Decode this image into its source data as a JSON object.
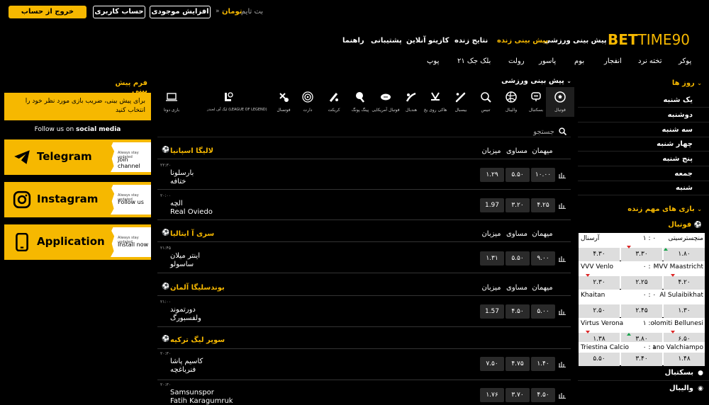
{
  "header": {
    "logout": "خروج از حساب کاربری",
    "account": "حساب کاربری",
    "deposit": "افزایش موجودی",
    "currency": "تومان",
    "balance_sep": "» ۰",
    "site_name": "بت تایم",
    "logo_bet": "BET",
    "logo_time": "TIME90"
  },
  "nav_main": [
    "پیش بینی ورزشی",
    "پیش بینی زنده",
    "نتایج زنده",
    "کازینو آنلاین",
    "پشتیبانی",
    "راهنما"
  ],
  "nav_casino": [
    "پوکر",
    "تخته نرد",
    "انفجار",
    "بوم",
    "پاسور",
    "رولت",
    "بلک جک ۲۱",
    "پوپ"
  ],
  "left": {
    "title": "فرم پیش بینی",
    "promo": "برای پیش بینی، ضریب بازی مورد نظر خود را انتخاب کنید",
    "follow_prefix": "Follow us on",
    "follow_bold": "social media",
    "socials": [
      {
        "title": "Telegram",
        "small": "Always stay updated",
        "action": "Join channel"
      },
      {
        "title": "Instagram",
        "small": "Always stay updated",
        "action": "Follow us"
      },
      {
        "title": "Application",
        "small": "Always stay updated",
        "action": "Install now"
      }
    ]
  },
  "center": {
    "title": "پیش بینی ورزشی",
    "search_placeholder": "جستجو",
    "sports": [
      {
        "label": "فوتبال",
        "icon": "soccer-ball-icon"
      },
      {
        "label": "بسکتبال",
        "icon": "basketball-icon"
      },
      {
        "label": "والیبال",
        "icon": "volleyball-icon"
      },
      {
        "label": "تنیس",
        "icon": "tennis-icon"
      },
      {
        "label": "بیسبال",
        "icon": "baseball-icon"
      },
      {
        "label": "هاکی روی یخ",
        "icon": "hockey-icon"
      },
      {
        "label": "هندبال",
        "icon": "handball-icon"
      },
      {
        "label": "فوتبال آمریکایی",
        "icon": "american-football-icon"
      },
      {
        "label": "پینگ پونگ",
        "icon": "ping-pong-icon"
      },
      {
        "label": "کریکت",
        "icon": "cricket-icon"
      },
      {
        "label": "دارت",
        "icon": "darts-icon"
      },
      {
        "label": "فوتسال",
        "icon": "futsal-icon"
      },
      {
        "label": "لیگ آف لجندز (LEAGUE OF LEGEND)",
        "icon": "league-of-legends-icon"
      },
      {
        "label": "بازی دوتا",
        "icon": "dota-icon"
      }
    ],
    "col_headers": {
      "home": "میزبان",
      "draw": "مساوی",
      "away": "میهمان"
    },
    "leagues": [
      {
        "name": "لالیگا اسپانیا",
        "matches": [
          {
            "time": "۲۲:۳۰",
            "home": "بارسلونا",
            "away": "ختافه",
            "o1": "۱.۲۹",
            "ox": "۵.۵۰",
            "o2": "۱۰.۰۰"
          },
          {
            "time": "۲۰:۰۰",
            "home": "الچه",
            "away": "Real Oviedo",
            "o1": "1.97",
            "ox": "۳.۲۰",
            "o2": "۴.۲۵"
          }
        ]
      },
      {
        "name": "سری آ ایتالیا",
        "matches": [
          {
            "time": "۲۱:۴۵",
            "home": "اینتر میلان",
            "away": "ساسولو",
            "o1": "۱.۳۱",
            "ox": "۵.۵۰",
            "o2": "۹.۰۰"
          }
        ]
      },
      {
        "name": "بوندسلیگا آلمان",
        "matches": [
          {
            "time": "۲۱:۰۰",
            "home": "دورتموند",
            "away": "ولفسبورگ",
            "o1": "1.57",
            "ox": "۴.۵۰",
            "o2": "۵.۰۰"
          }
        ]
      },
      {
        "name": "سوپر لیگ ترکیه",
        "matches": [
          {
            "time": "۲۰:۳۰",
            "home": "کاسیم پاشا",
            "away": "فنرباغچه",
            "o1": "۷.۵۰",
            "ox": "۴.۷۵",
            "o2": "۱.۴۰"
          },
          {
            "time": "۲۰:۳۰",
            "home": "Samsunspor",
            "away": "Fatih Karagumruk",
            "o1": "۱.۷۶",
            "ox": "۳.۷۰",
            "o2": "۴.۵۰"
          }
        ]
      }
    ]
  },
  "right": {
    "days_title": "روز ها",
    "days": [
      "یک شنبه",
      "دوشنبه",
      "سه شنبه",
      "چهار شنبه",
      "پنج شنبه",
      "جمعه",
      "شنبه"
    ],
    "important_title": "بازی های مهم زنده",
    "football_label": "فوتبال",
    "games": [
      {
        "home": "منچسترسیتی",
        "away": "آرسنال",
        "score": "۱ : ۰",
        "o1": "۱.۸۰",
        "ox": "۳.۳۰",
        "o2": "۴.۳۰"
      },
      {
        "home": "MVV Maastricht",
        "away": "VVV Venlo",
        "score": "۰ : ۰",
        "o1": "۴.۲۰",
        "ox": "۲.۲۵",
        "o2": "۲.۳۰"
      },
      {
        "home": "Al Sulaibikhat",
        "away": "Khaitan",
        "score": "۰ : ۰",
        "o1": "۱.۳۰",
        "ox": "۲.۴۵",
        "o2": "۲.۵۰"
      },
      {
        "home": "olomiti Bellunesi",
        "away": "Virtus Verona",
        "score": "۱ : ۰",
        "o1": "۶.۵۰",
        "ox": "۳.۸۰",
        "o2": "۱.۳۸"
      },
      {
        "home": "ano Valchiampo",
        "away": "Triestina Calcio",
        "score": "۰ : ۱",
        "o1": "۱.۴۸",
        "ox": "۳.۴۰",
        "o2": "۵.۵۰"
      }
    ],
    "more_sports": [
      "بسکتبال",
      "والیبال"
    ]
  },
  "colors": {
    "accent": "#f6b800",
    "bg": "#000000",
    "odd_bg": "#2a2a2a"
  }
}
